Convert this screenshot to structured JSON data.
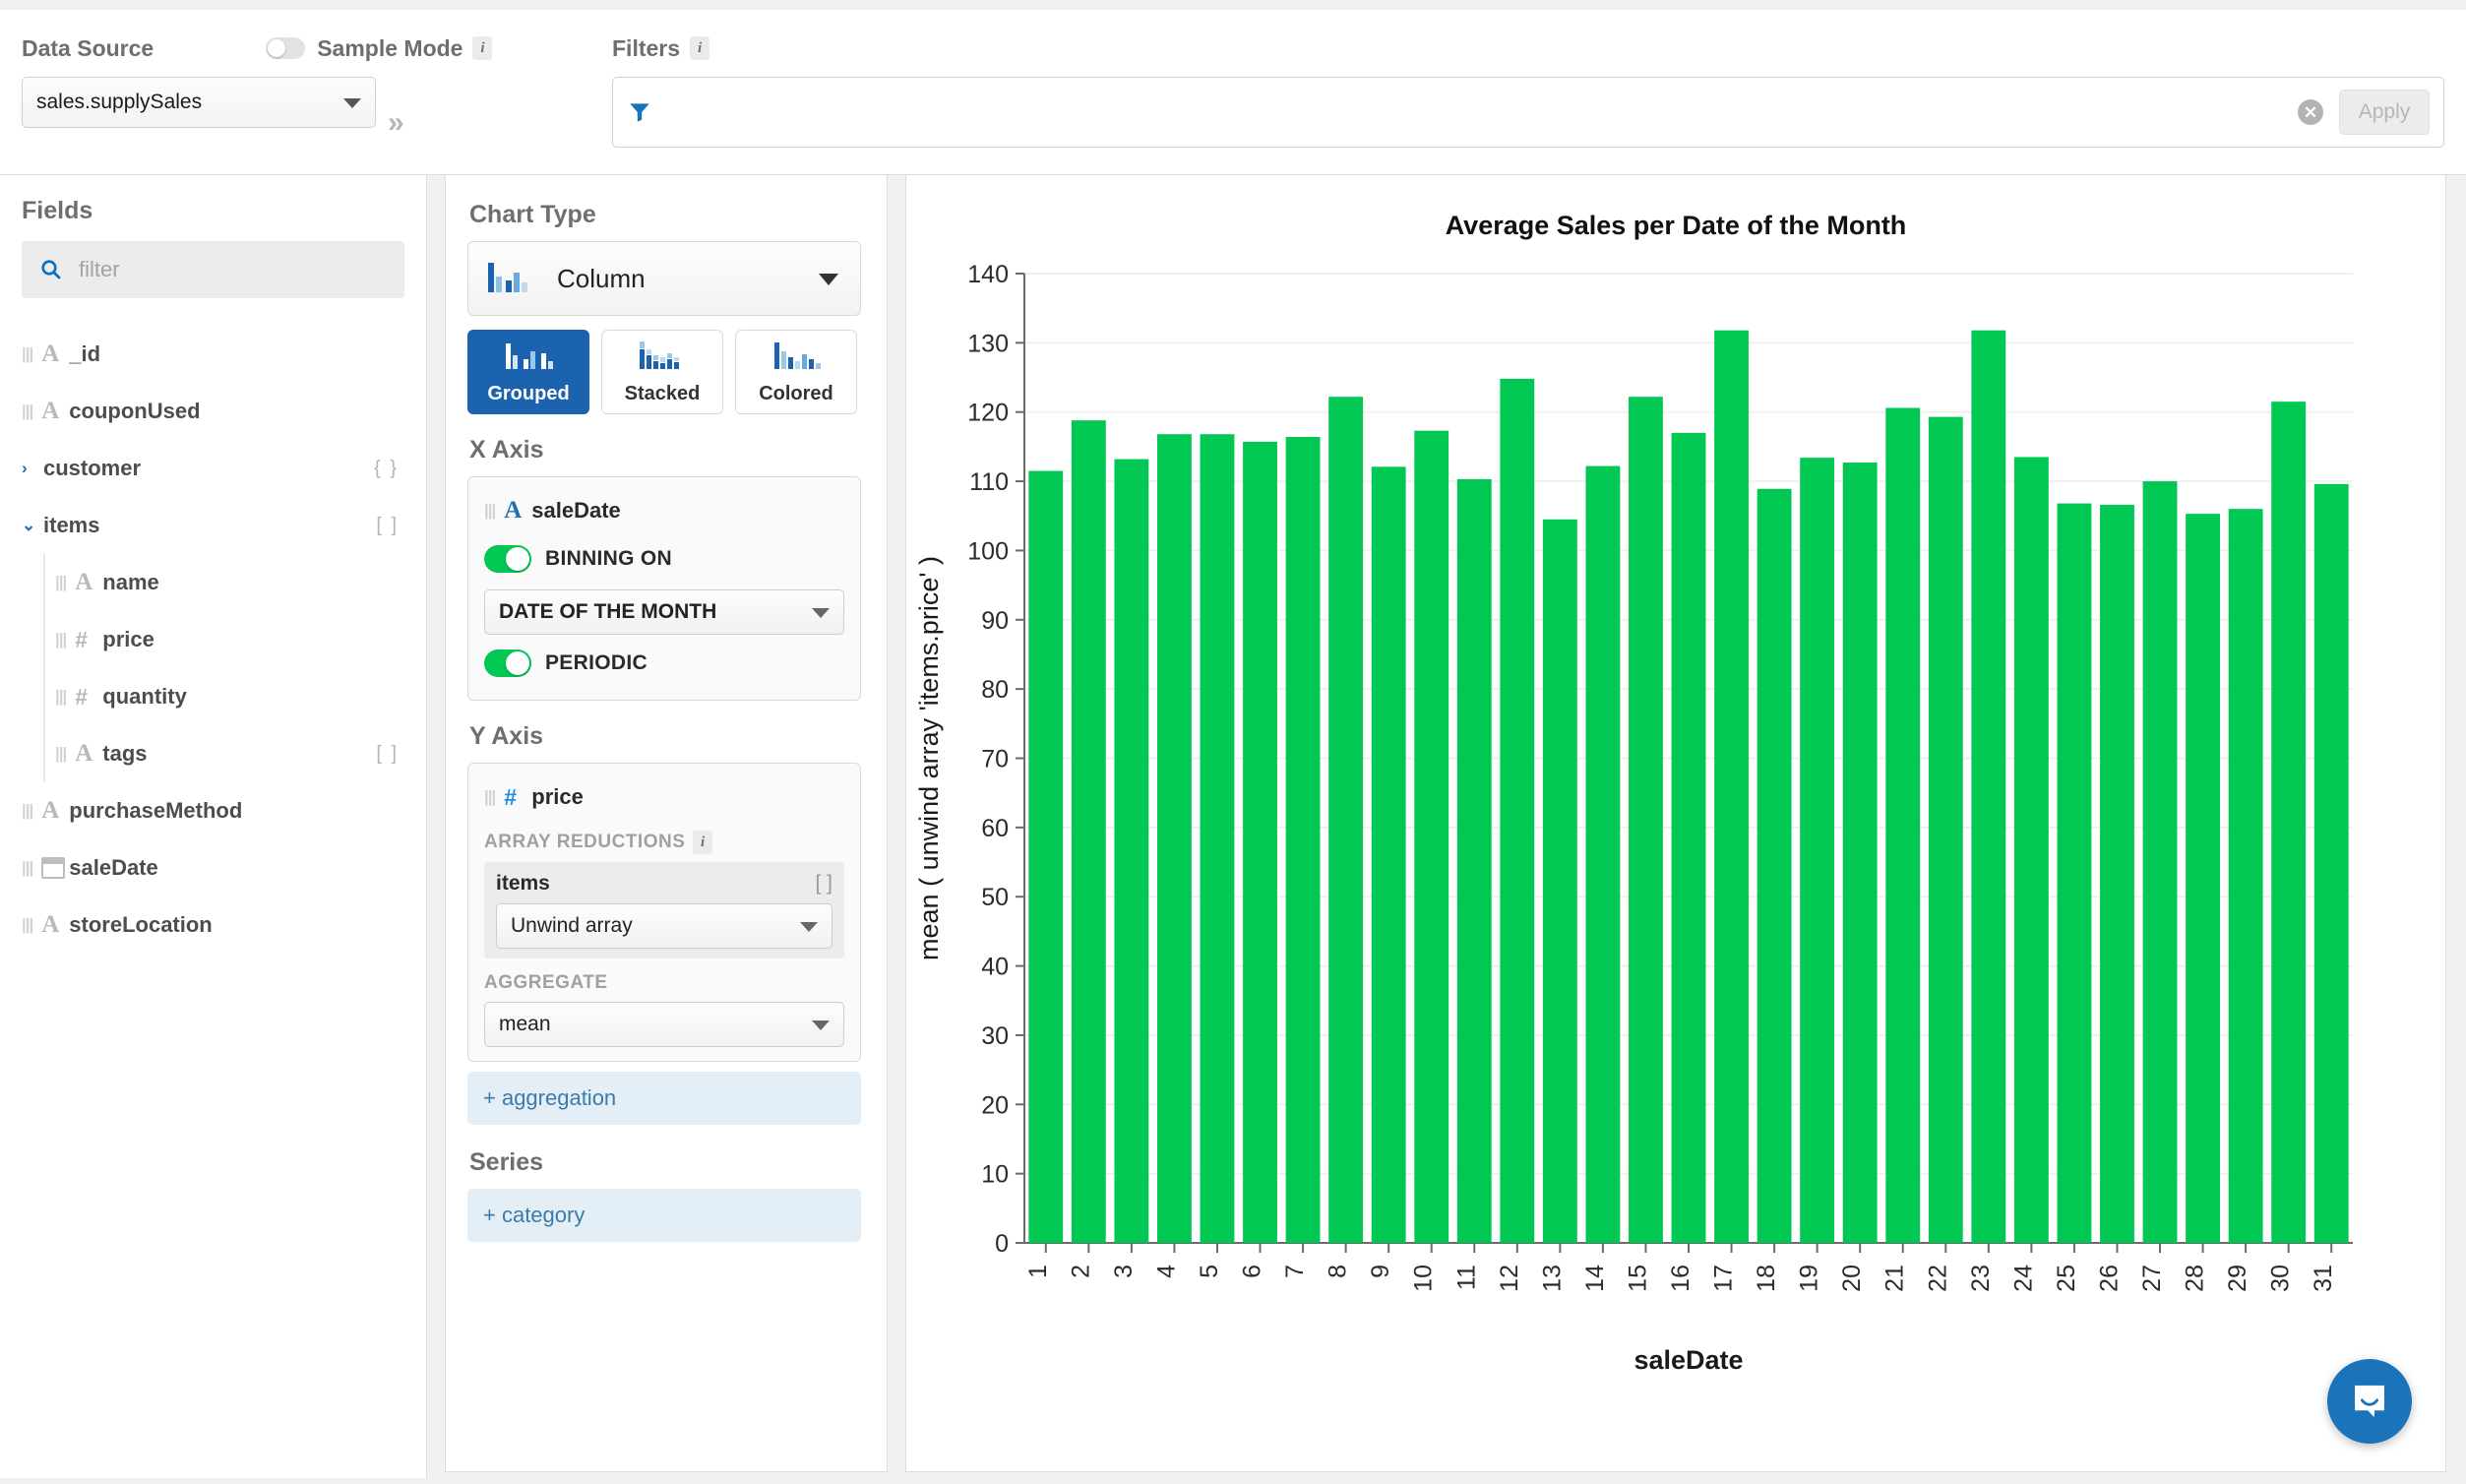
{
  "topbar": {
    "data_source_label": "Data Source",
    "sample_mode_label": "Sample Mode",
    "sample_mode_on": false,
    "info_glyph": "i",
    "data_source_value": "sales.supplySales",
    "expand_glyph": "»",
    "filters_label": "Filters",
    "filter_value": "",
    "filter_placeholder": "",
    "apply_label": "Apply",
    "clear_glyph": "✕",
    "accent_blue": "#1b74ba"
  },
  "fields": {
    "header": "Fields",
    "search_placeholder": "filter",
    "search_value": "",
    "items": [
      {
        "label": "_id",
        "type": "A",
        "depth": 0,
        "twisty": "",
        "badge": ""
      },
      {
        "label": "couponUsed",
        "type": "A",
        "depth": 0,
        "twisty": "",
        "badge": ""
      },
      {
        "label": "customer",
        "type": "",
        "depth": 0,
        "twisty": "›",
        "badge": "{ }"
      },
      {
        "label": "items",
        "type": "",
        "depth": 0,
        "twisty": "⌄",
        "badge": "[ ]"
      },
      {
        "label": "name",
        "type": "A",
        "depth": 1,
        "twisty": "",
        "badge": ""
      },
      {
        "label": "price",
        "type": "#",
        "depth": 1,
        "twisty": "",
        "badge": ""
      },
      {
        "label": "quantity",
        "type": "#",
        "depth": 1,
        "twisty": "",
        "badge": ""
      },
      {
        "label": "tags",
        "type": "A",
        "depth": 1,
        "twisty": "",
        "badge": "[ ]"
      },
      {
        "label": "purchaseMethod",
        "type": "A",
        "depth": 0,
        "twisty": "",
        "badge": ""
      },
      {
        "label": "saleDate",
        "type": "cal",
        "depth": 0,
        "twisty": "",
        "badge": ""
      },
      {
        "label": "storeLocation",
        "type": "A",
        "depth": 0,
        "twisty": "",
        "badge": ""
      }
    ]
  },
  "settings": {
    "chart_type_header": "Chart Type",
    "chart_type_value": "Column",
    "variant_buttons": [
      {
        "label": "Grouped",
        "active": true
      },
      {
        "label": "Stacked",
        "active": false
      },
      {
        "label": "Colored",
        "active": false
      }
    ],
    "x_axis_header": "X Axis",
    "x_axis_field": "saleDate",
    "x_axis_field_type": "A",
    "binning_label": "BINNING ON",
    "binning_on": true,
    "binning_value": "DATE OF THE MONTH",
    "periodic_label": "PERIODIC",
    "periodic_on": true,
    "y_axis_header": "Y Axis",
    "y_axis_field": "price",
    "y_axis_field_type": "#",
    "array_reductions_label": "ARRAY REDUCTIONS",
    "array_reduction_name": "items",
    "array_reduction_badge": "[ ]",
    "array_reduction_value": "Unwind array",
    "aggregate_label": "AGGREGATE",
    "aggregate_value": "mean",
    "add_aggregation_label": "+ aggregation",
    "series_header": "Series",
    "add_category_label": "+ category",
    "info_glyph": "i"
  },
  "chart_data": {
    "type": "bar",
    "title": "Average Sales per Date of the Month",
    "xlabel": "saleDate",
    "ylabel": "mean ( unwind array 'items.price' )",
    "ylim": [
      0,
      140
    ],
    "ytick_step": 10,
    "yticks": [
      0,
      10,
      20,
      30,
      40,
      50,
      60,
      70,
      80,
      90,
      100,
      110,
      120,
      130,
      140
    ],
    "grid": true,
    "legend": "none",
    "bar_color": "#00c853",
    "categories": [
      "1",
      "2",
      "3",
      "4",
      "5",
      "6",
      "7",
      "8",
      "9",
      "10",
      "11",
      "12",
      "13",
      "14",
      "15",
      "16",
      "17",
      "18",
      "19",
      "20",
      "21",
      "22",
      "23",
      "24",
      "25",
      "26",
      "27",
      "28",
      "29",
      "30",
      "31"
    ],
    "values": [
      111.5,
      118.8,
      113.2,
      116.8,
      116.8,
      115.7,
      116.4,
      122.2,
      112.1,
      117.3,
      110.3,
      124.8,
      104.5,
      112.2,
      122.2,
      117.0,
      131.8,
      108.9,
      113.4,
      112.7,
      120.6,
      119.3,
      131.8,
      113.5,
      106.8,
      106.6,
      110.0,
      105.3,
      106.0,
      121.5,
      109.6
    ]
  },
  "chat_widget": {
    "icon": "chat-bubble"
  }
}
